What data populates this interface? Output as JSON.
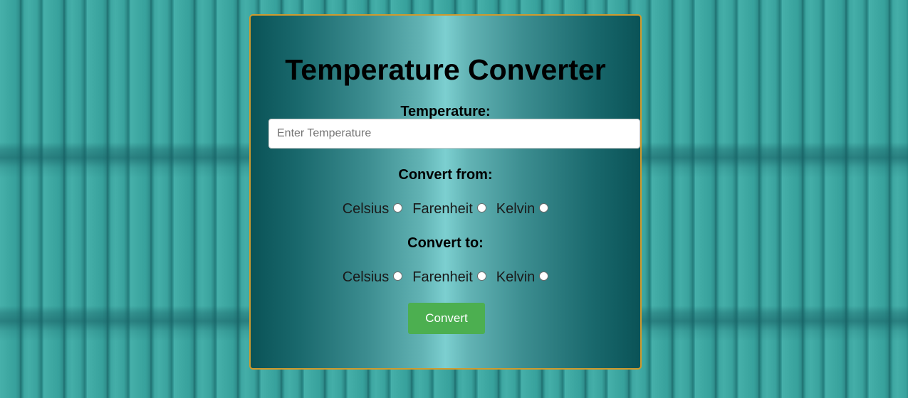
{
  "title": "Temperature Converter",
  "temperature": {
    "label": "Temperature:",
    "placeholder": "Enter Temperature",
    "value": ""
  },
  "convert_from": {
    "label": "Convert from:",
    "options": [
      "Celsius",
      "Farenheit",
      "Kelvin"
    ],
    "selected": null
  },
  "convert_to": {
    "label": "Convert to:",
    "options": [
      "Celsius",
      "Farenheit",
      "Kelvin"
    ],
    "selected": null
  },
  "button": {
    "label": "Convert",
    "color": "#4caf50"
  },
  "colors": {
    "card_border": "#d19a2c",
    "card_edge": "#0a5357",
    "card_center": "#7ccfd0"
  }
}
